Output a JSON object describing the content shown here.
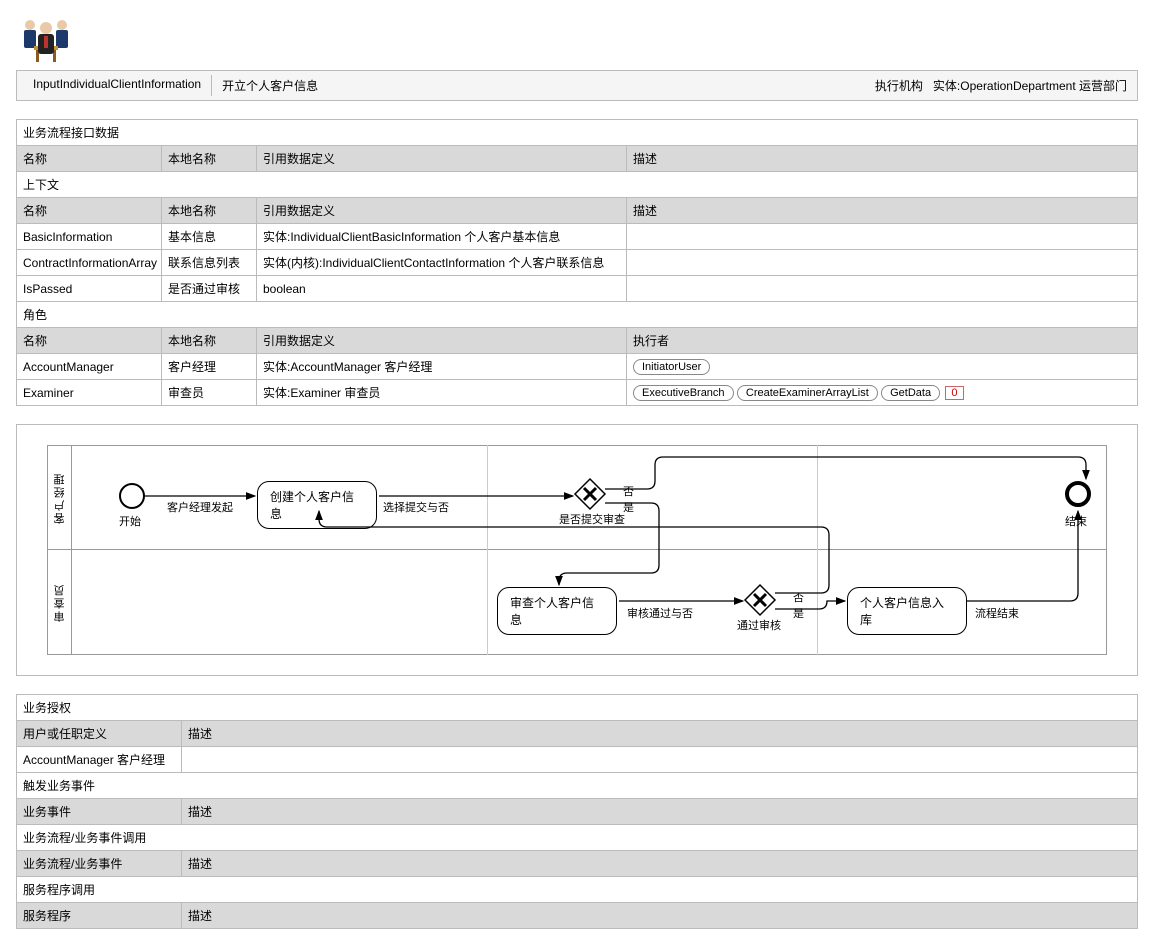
{
  "title": {
    "code": "InputIndividualClientInformation",
    "name": "开立个人客户信息",
    "exec_label": "执行机构",
    "exec_value": "实体:OperationDepartment 运营部门"
  },
  "sections": {
    "interface": "业务流程接口数据",
    "context": "上下文",
    "roles": "角色",
    "auth": "业务授权",
    "trigger": "触发业务事件",
    "invoke": "业务流程/业务事件调用",
    "service": "服务程序调用"
  },
  "headers": {
    "name": "名称",
    "local": "本地名称",
    "ref": "引用数据定义",
    "desc": "描述",
    "executor": "执行者",
    "auth_user": "用户或任职定义",
    "trigger_event": "业务事件",
    "invoke_item": "业务流程/业务事件",
    "service_item": "服务程序"
  },
  "context_rows": [
    {
      "name": "BasicInformation",
      "local": "基本信息",
      "ref": "实体:IndividualClientBasicInformation 个人客户基本信息",
      "desc": ""
    },
    {
      "name": "ContractInformationArray",
      "local": "联系信息列表",
      "ref": "实体(内核):IndividualClientContactInformation 个人客户联系信息",
      "desc": ""
    },
    {
      "name": "IsPassed",
      "local": "是否通过审核",
      "ref": "boolean",
      "desc": ""
    }
  ],
  "role_rows": [
    {
      "name": "AccountManager",
      "local": "客户经理",
      "ref": "实体:AccountManager 客户经理",
      "exec_pills": [
        "InitiatorUser"
      ],
      "idx": null
    },
    {
      "name": "Examiner",
      "local": "审查员",
      "ref": "实体:Examiner 审查员",
      "exec_pills": [
        "ExecutiveBranch",
        "CreateExaminerArrayList",
        "GetData"
      ],
      "idx": "0"
    }
  ],
  "auth_rows": [
    {
      "user": "AccountManager 客户经理",
      "desc": ""
    }
  ],
  "diagram": {
    "lane1": "客户经理",
    "lane2": "审查员",
    "start": "开始",
    "end": "结束",
    "task1": "创建个人客户信息",
    "task2": "审查个人客户信息",
    "task3": "个人客户信息入库",
    "gate1": "是否提交审查",
    "gate2": "通过审核",
    "lbl_initiate": "客户经理发起",
    "lbl_choose": "选择提交与否",
    "lbl_yes": "是",
    "lbl_no": "否",
    "lbl_passornot": "审核通过与否",
    "lbl_flowend": "流程结束"
  }
}
